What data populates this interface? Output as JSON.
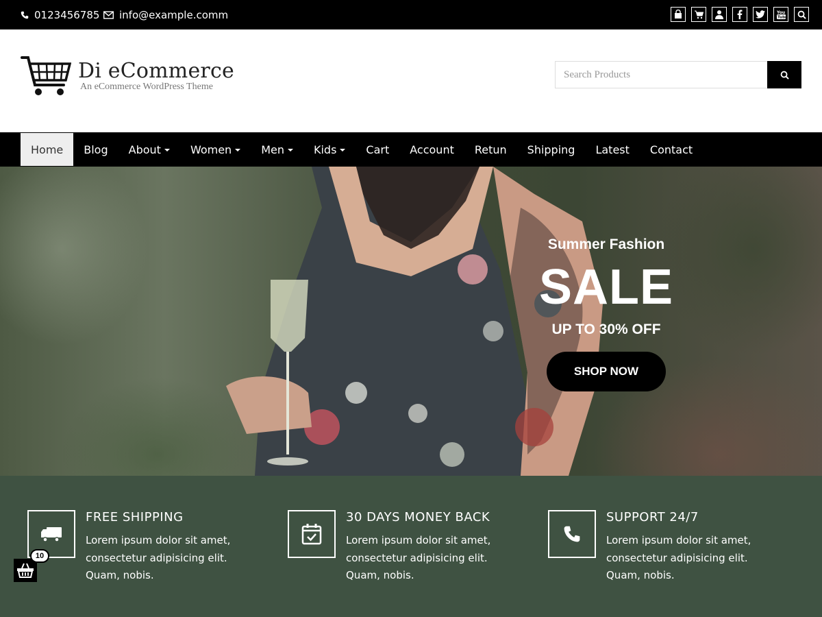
{
  "topbar": {
    "phone": "0123456785",
    "email": "info@example.comm",
    "social_icons": [
      "shopping-bag-icon",
      "cart-icon",
      "user-icon",
      "facebook-icon",
      "twitter-icon",
      "youtube-icon",
      "search-icon"
    ]
  },
  "header": {
    "site_title": "Di eCommerce",
    "tagline": "An eCommerce WordPress Theme",
    "search_placeholder": "Search Products"
  },
  "nav": {
    "items": [
      {
        "label": "Home",
        "active": true,
        "dropdown": false
      },
      {
        "label": "Blog",
        "dropdown": false
      },
      {
        "label": "About",
        "dropdown": true
      },
      {
        "label": "Women",
        "dropdown": true
      },
      {
        "label": "Men",
        "dropdown": true
      },
      {
        "label": "Kids",
        "dropdown": true
      },
      {
        "label": "Cart",
        "dropdown": false
      },
      {
        "label": "Account",
        "dropdown": false
      },
      {
        "label": "Retun",
        "dropdown": false
      },
      {
        "label": "Shipping",
        "dropdown": false
      },
      {
        "label": "Latest",
        "dropdown": false
      },
      {
        "label": "Contact",
        "dropdown": false
      }
    ]
  },
  "hero": {
    "subtitle": "Summer Fashion",
    "headline": "SALE",
    "offer": "UP TO 30% OFF",
    "cta": "SHOP NOW"
  },
  "features": [
    {
      "icon": "truck-icon",
      "title": "FREE SHIPPING",
      "desc": "Lorem ipsum dolor sit amet, consectetur adipisicing elit. Quam, nobis."
    },
    {
      "icon": "calendar-check-icon",
      "title": "30 DAYS MONEY BACK",
      "desc": "Lorem ipsum dolor sit amet, consectetur adipisicing elit. Quam, nobis."
    },
    {
      "icon": "phone-icon",
      "title": "SUPPORT 24/7",
      "desc": "Lorem ipsum dolor sit amet, consectetur adipisicing elit. Quam, nobis."
    }
  ],
  "cart_widget": {
    "count": "10"
  },
  "colors": {
    "topbar_bg": "#000000",
    "nav_bg": "#000000",
    "features_bg": "#3f5242",
    "accent": "#000000"
  }
}
